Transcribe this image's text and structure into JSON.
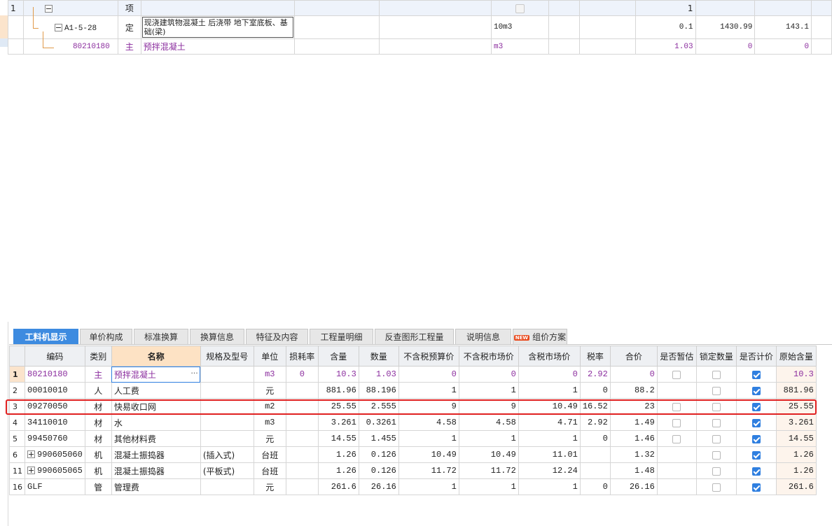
{
  "top_grid": {
    "rows": [
      {
        "num": "1",
        "code": "",
        "type": "项",
        "name": "",
        "unit": "",
        "qty": "",
        "price": "",
        "total": "1"
      },
      {
        "num": "",
        "code": "A1-5-28",
        "type": "定",
        "name": "现浇建筑物混凝土 后浇带 地下室底板、基础(梁)",
        "unit": "10m3",
        "qty": "0.1",
        "price": "1430.99",
        "total": "143.1"
      },
      {
        "num": "",
        "code": "80210180",
        "type": "主",
        "name": "预拌混凝土",
        "unit": "m3",
        "qty": "1.03",
        "price": "0",
        "total": "0"
      }
    ]
  },
  "tabs": [
    {
      "label": "工料机显示",
      "active": true
    },
    {
      "label": "单价构成"
    },
    {
      "label": "标准换算"
    },
    {
      "label": "换算信息"
    },
    {
      "label": "特征及内容"
    },
    {
      "label": "工程量明细"
    },
    {
      "label": "反查图形工程量"
    },
    {
      "label": "说明信息"
    },
    {
      "label": "组价方案",
      "badge": "NEW"
    }
  ],
  "columns": [
    "编码",
    "类别",
    "名称",
    "规格及型号",
    "单位",
    "损耗率",
    "含量",
    "数量",
    "不含税预算价",
    "不含税市场价",
    "含税市场价",
    "税率",
    "合价",
    "是否暂估",
    "锁定数量",
    "是否计价",
    "原始含量"
  ],
  "rows": [
    {
      "num": "1",
      "code": "80210180",
      "type": "主",
      "name": "预拌混凝土",
      "spec": "",
      "unit": "m3",
      "loss": "0",
      "content": "10.3",
      "qty": "1.03",
      "budget": "0",
      "market": "0",
      "taxmarket": "0",
      "tax": "2.92",
      "total": "0",
      "est": false,
      "lock": false,
      "priced": true,
      "orig": "10.3"
    },
    {
      "num": "2",
      "code": "00010010",
      "type": "人",
      "name": "人工费",
      "spec": "",
      "unit": "元",
      "loss": "",
      "content": "881.96",
      "qty": "88.196",
      "budget": "1",
      "market": "1",
      "taxmarket": "1",
      "tax": "0",
      "total": "88.2",
      "est": null,
      "lock": false,
      "priced": true,
      "orig": "881.96"
    },
    {
      "num": "3",
      "code": "09270050",
      "type": "材",
      "name": "快易收口网",
      "spec": "",
      "unit": "m2",
      "loss": "",
      "content": "25.55",
      "qty": "2.555",
      "budget": "9",
      "market": "9",
      "taxmarket": "10.49",
      "tax": "16.52",
      "total": "23",
      "est": false,
      "lock": false,
      "priced": true,
      "orig": "25.55"
    },
    {
      "num": "4",
      "code": "34110010",
      "type": "材",
      "name": "水",
      "spec": "",
      "unit": "m3",
      "loss": "",
      "content": "3.261",
      "qty": "0.3261",
      "budget": "4.58",
      "market": "4.58",
      "taxmarket": "4.71",
      "tax": "2.92",
      "total": "1.49",
      "est": false,
      "lock": false,
      "priced": true,
      "orig": "3.261"
    },
    {
      "num": "5",
      "code": "99450760",
      "type": "材",
      "name": "其他材料费",
      "spec": "",
      "unit": "元",
      "loss": "",
      "content": "14.55",
      "qty": "1.455",
      "budget": "1",
      "market": "1",
      "taxmarket": "1",
      "tax": "0",
      "total": "1.46",
      "est": false,
      "lock": false,
      "priced": true,
      "orig": "14.55"
    },
    {
      "num": "6",
      "code": "990605060",
      "type": "机",
      "name": "混凝土振捣器",
      "spec": "(插入式)",
      "unit": "台班",
      "loss": "",
      "content": "1.26",
      "qty": "0.126",
      "budget": "10.49",
      "market": "10.49",
      "taxmarket": "11.01",
      "tax": "",
      "total": "1.32",
      "est": null,
      "lock": false,
      "priced": true,
      "orig": "1.26",
      "expand": true
    },
    {
      "num": "11",
      "code": "990605065",
      "type": "机",
      "name": "混凝土振捣器",
      "spec": "(平板式)",
      "unit": "台班",
      "loss": "",
      "content": "1.26",
      "qty": "0.126",
      "budget": "11.72",
      "market": "11.72",
      "taxmarket": "12.24",
      "tax": "",
      "total": "1.48",
      "est": null,
      "lock": false,
      "priced": true,
      "orig": "1.26",
      "expand": true
    },
    {
      "num": "16",
      "code": "GLF",
      "type": "管",
      "name": "管理费",
      "spec": "",
      "unit": "元",
      "loss": "",
      "content": "261.6",
      "qty": "26.16",
      "budget": "1",
      "market": "1",
      "taxmarket": "1",
      "tax": "0",
      "total": "26.16",
      "est": null,
      "lock": false,
      "priced": true,
      "orig": "261.6"
    }
  ],
  "colors": {
    "accent": "#3d8be0",
    "highlight": "#e02020",
    "purple": "#8b2d9e",
    "selected_row": "#fbe4cc"
  }
}
